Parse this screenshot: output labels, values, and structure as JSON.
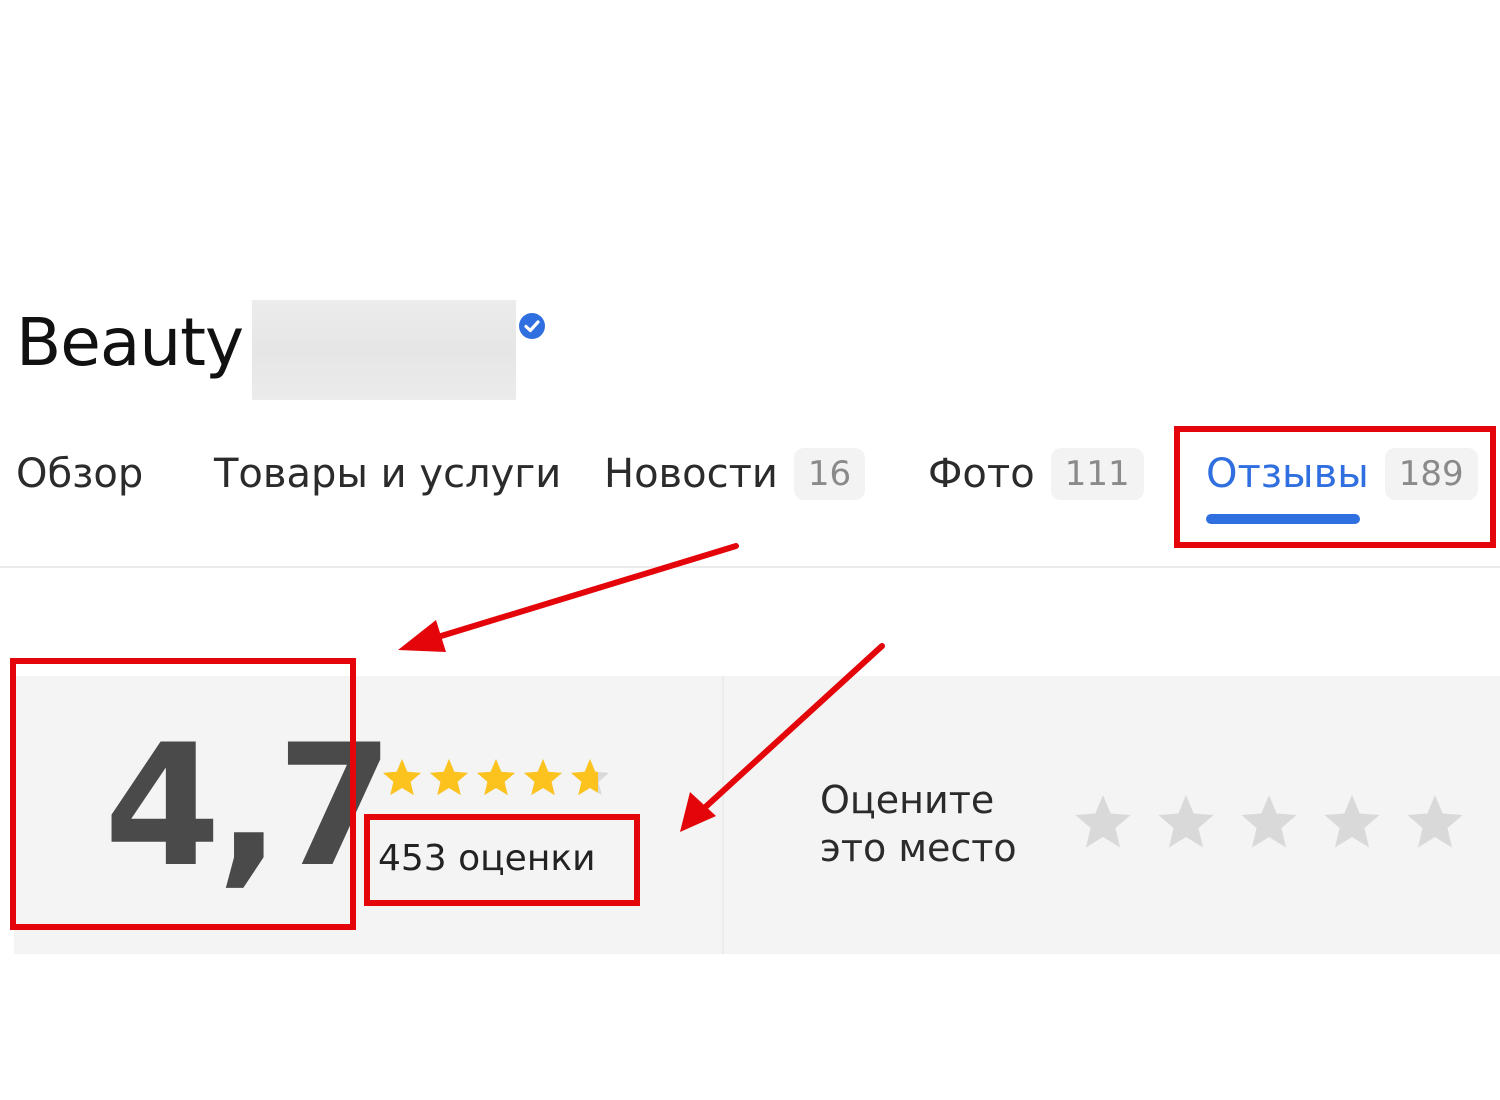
{
  "header": {
    "title": "Beauty",
    "verified_icon": "verified-check-icon"
  },
  "tabs": [
    {
      "label": "Обзор",
      "count": null
    },
    {
      "label": "Товары и услуги",
      "count": null
    },
    {
      "label": "Новости",
      "count": "16"
    },
    {
      "label": "Фото",
      "count": "111"
    },
    {
      "label": "Отзывы",
      "count": "189",
      "active": true
    }
  ],
  "rating": {
    "score": "4,7",
    "stars_value": 4.7,
    "stars_max": 5,
    "count_text": "453 оценки"
  },
  "rate_place": {
    "label": "Оцените это место",
    "stars_max": 5
  },
  "colors": {
    "accent": "#2f6fe0",
    "star_filled": "#fcc31e",
    "star_empty": "#d9d9d9",
    "annotation": "#e3050a"
  }
}
